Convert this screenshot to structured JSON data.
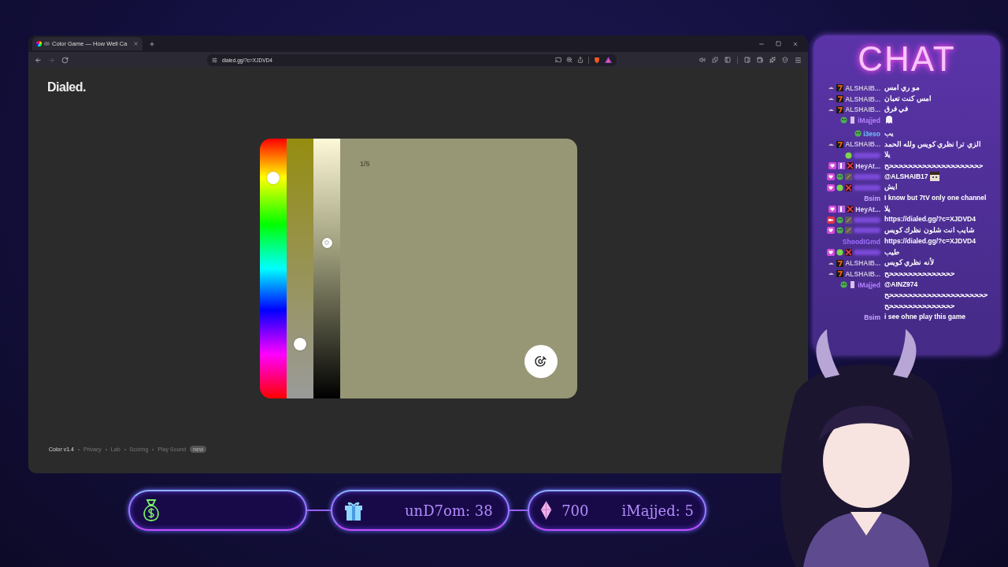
{
  "browser": {
    "tab": {
      "title": "Color Game — How Well Ca"
    },
    "url": "dialed.gg/?c=XJDVD4"
  },
  "page": {
    "logo": "Dialed.",
    "game": {
      "round": "1/5"
    },
    "footer": {
      "version": "Color v1.4",
      "links": [
        "Privacy",
        "Lab",
        "Scoring",
        "Play Sound"
      ],
      "badge": "new"
    }
  },
  "chat": {
    "title": "CHAT",
    "messages": [
      {
        "name": "ALSHAIB...",
        "color": "#c8c0d8",
        "badges": [
          {
            "kind": "hat"
          },
          {
            "kind": "seven"
          }
        ],
        "kind": "text",
        "text": "مو ري امس"
      },
      {
        "name": "ALSHAIB...",
        "color": "#c8c0d8",
        "badges": [
          {
            "kind": "hat"
          },
          {
            "kind": "seven"
          }
        ],
        "kind": "text",
        "text": "امس كنت تعبان"
      },
      {
        "name": "ALSHAIB...",
        "color": "#c8c0d8",
        "badges": [
          {
            "kind": "hat"
          },
          {
            "kind": "seven"
          }
        ],
        "kind": "text",
        "text": "في فرق"
      },
      {
        "name": "iMajjed",
        "color": "#b580ff",
        "badges": [
          {
            "kind": "smile"
          },
          {
            "kind": "bar"
          }
        ],
        "kind": "emote"
      },
      {
        "name": "i3eso",
        "color": "#6fc0ff",
        "badges": [
          {
            "kind": "smile"
          }
        ],
        "kind": "text",
        "text": "يب"
      },
      {
        "name": "ALSHAIB...",
        "color": "#c8c0d8",
        "badges": [
          {
            "kind": "hat"
          },
          {
            "kind": "seven"
          }
        ],
        "kind": "text",
        "text": "الزي ترا نظري كويس ولله الحمد"
      },
      {
        "badges": [
          {
            "kind": "blob"
          }
        ],
        "kind": "text",
        "text": "يلا"
      },
      {
        "name": "HeyAt...",
        "color": "#e0d8f0",
        "badges": [
          {
            "kind": "heart"
          },
          {
            "kind": "prime"
          },
          {
            "kind": "grid"
          }
        ],
        "kind": "text",
        "text": "ححححححححححححححححححححح"
      },
      {
        "badges": [
          {
            "kind": "heart"
          },
          {
            "kind": "smile"
          },
          {
            "kind": "pencil"
          }
        ],
        "kind": "text_emote",
        "text": "@ALSHAIB17"
      },
      {
        "badges": [
          {
            "kind": "heart"
          },
          {
            "kind": "blob"
          },
          {
            "kind": "grid"
          }
        ],
        "kind": "text",
        "text": "ايش"
      },
      {
        "name": "Bsim",
        "color": "#c8a8ff",
        "kind": "text",
        "text": "I know but 7tV only one channel"
      },
      {
        "name": "HeyAt...",
        "color": "#e0d8f0",
        "badges": [
          {
            "kind": "heart"
          },
          {
            "kind": "prime"
          },
          {
            "kind": "grid"
          }
        ],
        "kind": "text",
        "text": "يلا"
      },
      {
        "badges": [
          {
            "kind": "video"
          },
          {
            "kind": "smile"
          },
          {
            "kind": "pencil"
          }
        ],
        "kind": "text",
        "text": "https://dialed.gg/?c=XJDVD4"
      },
      {
        "badges": [
          {
            "kind": "heart"
          },
          {
            "kind": "smile"
          },
          {
            "kind": "pencil"
          }
        ],
        "kind": "text",
        "text": "شايب انت شلون نظرك كويس"
      },
      {
        "name": "ShoodIGmd",
        "color": "#a070ff",
        "kind": "text",
        "text": "https://dialed.gg/?c=XJDVD4"
      },
      {
        "badges": [
          {
            "kind": "heart"
          },
          {
            "kind": "blob"
          },
          {
            "kind": "grid"
          }
        ],
        "kind": "text",
        "text": "طيب"
      },
      {
        "name": "ALSHAIB...",
        "color": "#c8c0d8",
        "badges": [
          {
            "kind": "hat"
          },
          {
            "kind": "seven"
          }
        ],
        "kind": "text",
        "text": "لأنه نظري كويس"
      },
      {
        "name": "ALSHAIB...",
        "color": "#c8c0d8",
        "badges": [
          {
            "kind": "hat"
          },
          {
            "kind": "seven"
          }
        ],
        "kind": "text",
        "text": "ححححححححححححححح"
      },
      {
        "name": "iMajjed",
        "color": "#b580ff",
        "badges": [
          {
            "kind": "smile"
          },
          {
            "kind": "bar"
          }
        ],
        "kind": "lines",
        "lines": [
          "@AINZ974",
          "حححححححححححححححححححححح",
          "ححححححححححححححح"
        ]
      },
      {
        "name": "Bsim",
        "color": "#c8a8ff",
        "kind": "text",
        "text": "i see ohne play this game"
      }
    ]
  },
  "bars": [
    {
      "kind": "money"
    },
    {
      "kind": "gift",
      "texts": [
        "unD7om: 38"
      ]
    },
    {
      "kind": "gem",
      "texts": [
        "700",
        "iMajjed: 5"
      ]
    }
  ]
}
